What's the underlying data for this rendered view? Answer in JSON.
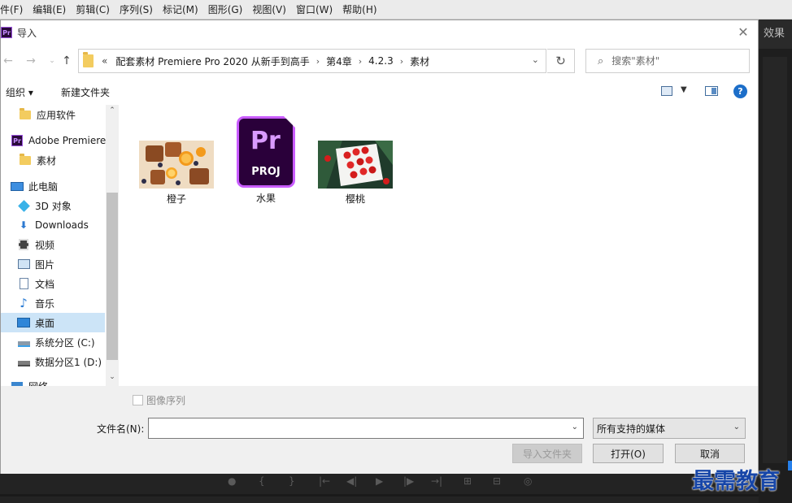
{
  "menubar": {
    "items": [
      "件(F)",
      "编辑(E)",
      "剪辑(C)",
      "序列(S)",
      "标记(M)",
      "图形(G)",
      "视图(V)",
      "窗口(W)",
      "帮助(H)"
    ]
  },
  "background": {
    "right_tab": "效果"
  },
  "dialog": {
    "title": "导入",
    "app_badge": "Pr",
    "breadcrumb": {
      "overflow": "«",
      "items": [
        "配套素材 Premiere Pro 2020 从新手到高手",
        "第4章",
        "4.2.3",
        "素材"
      ]
    },
    "search_placeholder": "搜索\"素材\"",
    "toolbar": {
      "organize": "组织 ▾",
      "new_folder": "新建文件夹"
    },
    "sidebar": [
      {
        "label": "应用软件",
        "icon": "folder-icon",
        "selected": false
      },
      {
        "label": "Adobe Premiere",
        "icon": "premiere-icon",
        "selected": false
      },
      {
        "label": "素材",
        "icon": "folder-icon",
        "selected": false
      },
      {
        "label": "此电脑",
        "icon": "computer-icon",
        "selected": false
      },
      {
        "label": "3D 对象",
        "icon": "cube-icon",
        "selected": false
      },
      {
        "label": "Downloads",
        "icon": "download-icon",
        "selected": false
      },
      {
        "label": "视频",
        "icon": "video-icon",
        "selected": false
      },
      {
        "label": "图片",
        "icon": "picture-icon",
        "selected": false
      },
      {
        "label": "文档",
        "icon": "document-icon",
        "selected": false
      },
      {
        "label": "音乐",
        "icon": "music-icon",
        "selected": false
      },
      {
        "label": "桌面",
        "icon": "desktop-icon",
        "selected": true
      },
      {
        "label": "系统分区 (C:)",
        "icon": "system-drive-icon",
        "selected": false
      },
      {
        "label": "数据分区1 (D:)",
        "icon": "drive-icon",
        "selected": false
      },
      {
        "label": "网络",
        "icon": "network-icon",
        "selected": false
      }
    ],
    "files": [
      {
        "name": "橙子",
        "type": "image"
      },
      {
        "name": "水果",
        "type": "premiere-project",
        "icon_text": "Pr",
        "icon_sub": "PROJ"
      },
      {
        "name": "樱桃",
        "type": "image"
      }
    ],
    "image_sequence_label": "图像序列",
    "filename_label": "文件名(N):",
    "filename_value": "",
    "filetype_value": "所有支持的媒体",
    "buttons": {
      "import_folder": "导入文件夹",
      "open": "打开(O)",
      "cancel": "取消"
    }
  },
  "watermark": "最需教育",
  "colors": {
    "selection": "#cce4f7",
    "premiere_purple": "#c95cff",
    "help_blue": "#1c6ec9",
    "watermark_blue": "#1746a8"
  }
}
